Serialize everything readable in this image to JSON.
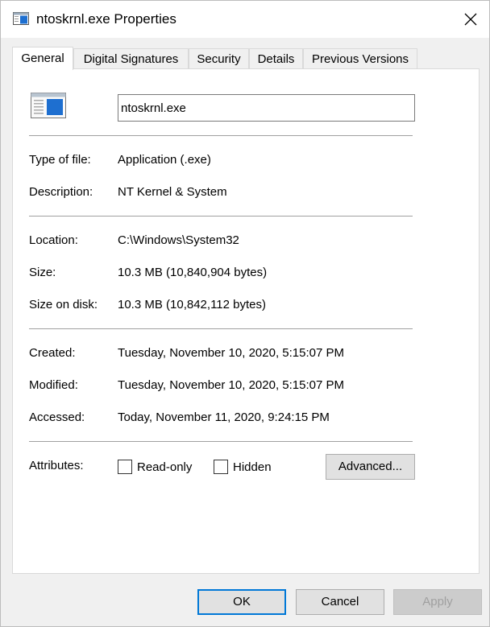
{
  "window": {
    "title": "ntoskrnl.exe Properties",
    "close_icon": "close-icon",
    "accent": "#0078d7"
  },
  "tabs": [
    {
      "label": "General",
      "active": true
    },
    {
      "label": "Digital Signatures",
      "active": false
    },
    {
      "label": "Security",
      "active": false
    },
    {
      "label": "Details",
      "active": false
    },
    {
      "label": "Previous Versions",
      "active": false
    }
  ],
  "general": {
    "file_name": "ntoskrnl.exe",
    "type_of_file": {
      "label": "Type of file:",
      "value": "Application (.exe)"
    },
    "description": {
      "label": "Description:",
      "value": "NT Kernel & System"
    },
    "location": {
      "label": "Location:",
      "value": "C:\\Windows\\System32"
    },
    "size": {
      "label": "Size:",
      "value": "10.3 MB (10,840,904 bytes)"
    },
    "size_on_disk": {
      "label": "Size on disk:",
      "value": "10.3 MB (10,842,112 bytes)"
    },
    "created": {
      "label": "Created:",
      "value": "Tuesday, November 10, 2020, 5:15:07 PM"
    },
    "modified": {
      "label": "Modified:",
      "value": "Tuesday, November 10, 2020, 5:15:07 PM"
    },
    "accessed": {
      "label": "Accessed:",
      "value": "Today, November 11, 2020, 9:24:15 PM"
    },
    "attributes": {
      "label": "Attributes:",
      "read_only": {
        "label": "Read-only",
        "checked": false
      },
      "hidden": {
        "label": "Hidden",
        "checked": false
      },
      "advanced_label": "Advanced..."
    }
  },
  "footer": {
    "ok_label": "OK",
    "cancel_label": "Cancel",
    "apply_label": "Apply"
  }
}
